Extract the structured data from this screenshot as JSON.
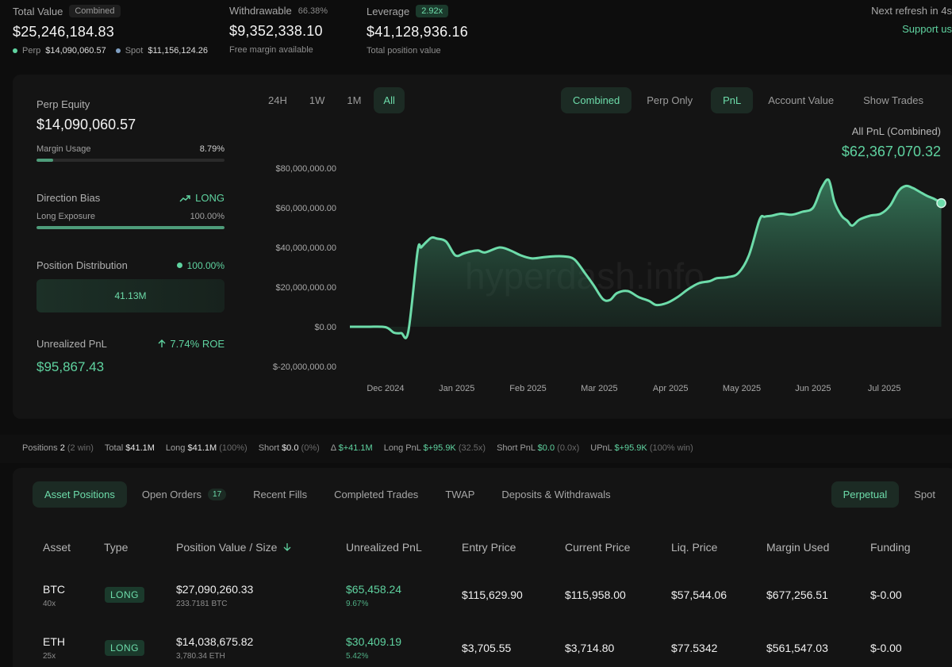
{
  "summary": {
    "total_value": {
      "label": "Total Value",
      "pill": "Combined",
      "value": "$25,246,184.83",
      "perp_label": "Perp",
      "perp_value": "$14,090,060.57",
      "spot_label": "Spot",
      "spot_value": "$11,156,124.26"
    },
    "withdrawable": {
      "label": "Withdrawable",
      "pct": "66.38%",
      "value": "$9,352,338.10",
      "sub": "Free margin available"
    },
    "leverage": {
      "label": "Leverage",
      "pill": "2.92x",
      "value": "$41,128,936.16",
      "sub": "Total position value"
    },
    "refresh": "Next refresh in 4s",
    "support": "Support us"
  },
  "side": {
    "perp_equity_label": "Perp Equity",
    "perp_equity_value": "$14,090,060.57",
    "margin_usage_label": "Margin Usage",
    "margin_usage_value": "8.79%",
    "margin_usage_fraction": 0.0879,
    "direction_label": "Direction Bias",
    "direction_value": "LONG",
    "long_exposure_label": "Long Exposure",
    "long_exposure_value": "100.00%",
    "long_exposure_fraction": 1.0,
    "distribution_label": "Position Distribution",
    "distribution_value": "100.00%",
    "distribution_box": "41.13M",
    "upnl_label": "Unrealized PnL",
    "upnl_roe": "7.74% ROE",
    "upnl_value": "$95,867.43"
  },
  "timeframes": [
    "24H",
    "1W",
    "1M",
    "All"
  ],
  "active_timeframe": 3,
  "modes": [
    "Combined",
    "Perp Only"
  ],
  "metrics": [
    "PnL",
    "Account Value"
  ],
  "show_trades": "Show Trades",
  "chart_head": {
    "title": "All PnL (Combined)",
    "value": "$62,367,070.32"
  },
  "chart_data": {
    "type": "area",
    "title": "All PnL (Combined)",
    "xlabel": "",
    "ylabel": "",
    "ylim": [
      -20000000,
      80000000
    ],
    "y_ticks": [
      "$80,000,000.00",
      "$60,000,000.00",
      "$40,000,000.00",
      "$20,000,000.00",
      "$0.00",
      "$-20,000,000.00"
    ],
    "y_tick_values": [
      80000000,
      60000000,
      40000000,
      20000000,
      0,
      -20000000
    ],
    "x_ticks": [
      "Dec 2024",
      "Jan 2025",
      "Feb 2025",
      "Mar 2025",
      "Apr 2025",
      "May 2025",
      "Jun 2025",
      "Jul 2025"
    ],
    "x_tick_values": [
      0.5,
      1.5,
      2.5,
      3.5,
      4.5,
      5.5,
      6.5,
      7.5
    ],
    "grid": false,
    "x_range": [
      0,
      8.35
    ],
    "series": [
      {
        "x": [
          0.0,
          0.25,
          0.5,
          0.62,
          0.72,
          0.82,
          0.95,
          1.0,
          1.08,
          1.15,
          1.22,
          1.35,
          1.48,
          1.6,
          1.7,
          1.8,
          1.9,
          2.1,
          2.25,
          2.4,
          2.55,
          2.7,
          2.85,
          3.0,
          3.15,
          3.3,
          3.42,
          3.55,
          3.65,
          3.75,
          3.9,
          4.05,
          4.2,
          4.3,
          4.45,
          4.6,
          4.75,
          4.9,
          5.05,
          5.15,
          5.3,
          5.45,
          5.6,
          5.75,
          5.82,
          5.92,
          6.05,
          6.2,
          6.35,
          6.5,
          6.62,
          6.72,
          6.8,
          6.9,
          6.98,
          7.05,
          7.15,
          7.3,
          7.45,
          7.58,
          7.7,
          7.8,
          7.9,
          8.0,
          8.1,
          8.2,
          8.3
        ],
        "y": [
          0,
          0,
          -200000,
          -3000000,
          -3200000,
          -2500000,
          38000000,
          40000000,
          43000000,
          45000000,
          44500000,
          43000000,
          36000000,
          37000000,
          38000000,
          38500000,
          37500000,
          40000000,
          38500000,
          36000000,
          34500000,
          35000000,
          35500000,
          35500000,
          34000000,
          27000000,
          21000000,
          14000000,
          13500000,
          17000000,
          18000000,
          15000000,
          13000000,
          11000000,
          12000000,
          15000000,
          19000000,
          22000000,
          23000000,
          24500000,
          25000000,
          27000000,
          36000000,
          54000000,
          55500000,
          56000000,
          57000000,
          56500000,
          58000000,
          60000000,
          70000000,
          74000000,
          63000000,
          56000000,
          53500000,
          51000000,
          54000000,
          56000000,
          57000000,
          61000000,
          68500000,
          71000000,
          70000000,
          68000000,
          66000000,
          64500000,
          62367070
        ]
      }
    ]
  },
  "watermark": "hyperdash.info",
  "strip": {
    "positions_label": "Positions",
    "positions_value": "2",
    "positions_note": "(2 win)",
    "total_label": "Total",
    "total_value": "$41.1M",
    "long_label": "Long",
    "long_value": "$41.1M",
    "long_note": "(100%)",
    "short_label": "Short",
    "short_value": "$0.0",
    "short_note": "(0%)",
    "delta_label": "Δ",
    "delta_value": "$+41.1M",
    "longpnl_label": "Long PnL",
    "longpnl_value": "$+95.9K",
    "longpnl_note": "(32.5x)",
    "shortpnl_label": "Short PnL",
    "shortpnl_value": "$0.0",
    "shortpnl_note": "(0.0x)",
    "upnl_label": "UPnL",
    "upnl_value": "$+95.9K",
    "upnl_note": "(100% win)"
  },
  "tabs": [
    "Asset Positions",
    "Open Orders",
    "Recent Fills",
    "Completed Trades",
    "TWAP",
    "Deposits & Withdrawals"
  ],
  "open_orders_badge": "17",
  "ptabs": [
    "Perpetual",
    "Spot"
  ],
  "table": {
    "headers": [
      "Asset",
      "Type",
      "Position Value / Size",
      "Unrealized PnL",
      "Entry Price",
      "Current Price",
      "Liq. Price",
      "Margin Used",
      "Funding"
    ],
    "rows": [
      {
        "asset": "BTC",
        "lev": "40x",
        "type": "LONG",
        "value": "$27,090,260.33",
        "size": "233.7181 BTC",
        "upnl": "$65,458.24",
        "upnl_pct": "9.67%",
        "entry": "$115,629.90",
        "current": "$115,958.00",
        "liq": "$57,544.06",
        "margin": "$677,256.51",
        "funding": "$-0.00"
      },
      {
        "asset": "ETH",
        "lev": "25x",
        "type": "LONG",
        "value": "$14,038,675.82",
        "size": "3,780.34 ETH",
        "upnl": "$30,409.19",
        "upnl_pct": "5.42%",
        "entry": "$3,705.55",
        "current": "$3,714.80",
        "liq": "$77.5342",
        "margin": "$561,547.03",
        "funding": "$-0.00"
      }
    ]
  }
}
